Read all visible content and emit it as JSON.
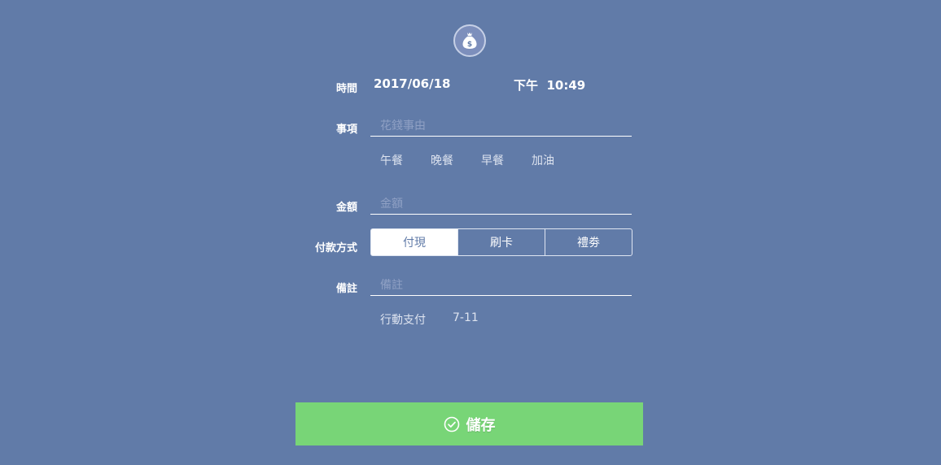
{
  "header": {
    "logo_icon": "money-bag-icon"
  },
  "time": {
    "label": "時間",
    "date": "2017/06/18",
    "clock": "下午  10:49"
  },
  "item": {
    "label": "事項",
    "placeholder": "花錢事由",
    "value": "",
    "suggestions": [
      "午餐",
      "晚餐",
      "早餐",
      "加油"
    ]
  },
  "amount": {
    "label": "金額",
    "placeholder": "金額",
    "value": ""
  },
  "payment": {
    "label": "付款方式",
    "options": [
      "付現",
      "刷卡",
      "禮劵"
    ],
    "selected": "付現"
  },
  "note": {
    "label": "備註",
    "placeholder": "備註",
    "value": "",
    "suggestions": [
      "行動支付",
      "7-11"
    ]
  },
  "save": {
    "label": "儲存",
    "icon": "check-circle-icon"
  },
  "colors": {
    "background": "#617ba8",
    "save_button": "#78d577",
    "segment_active_bg": "#ffffff",
    "segment_active_text": "#617ba8"
  }
}
